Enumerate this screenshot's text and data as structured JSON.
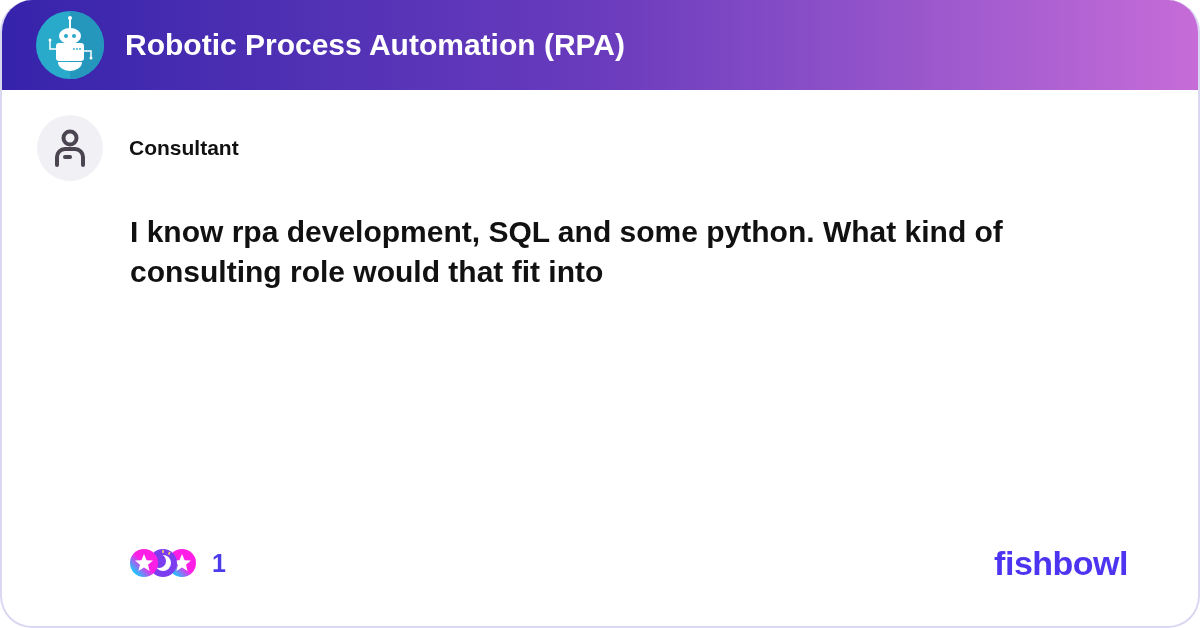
{
  "header": {
    "title": "Robotic Process Automation (RPA)"
  },
  "post": {
    "author": "Consultant",
    "text": "I know rpa development, SQL and some python. What kind of consulting role would that fit into"
  },
  "footer": {
    "reaction_count": "1",
    "brand": "fishbowl"
  }
}
